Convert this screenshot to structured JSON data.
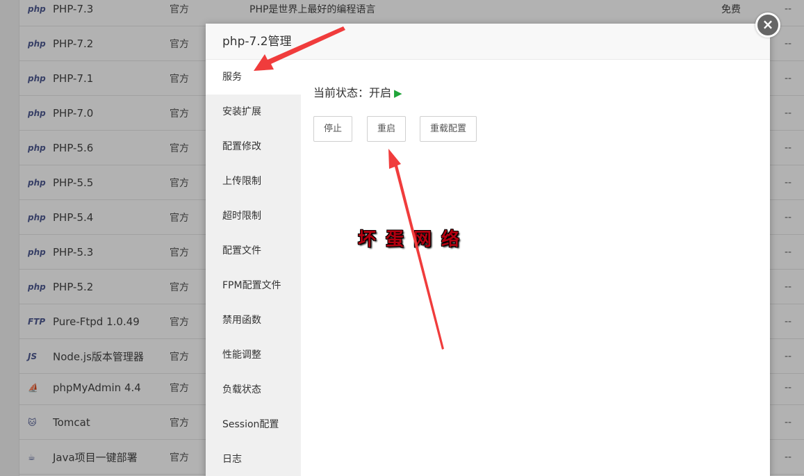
{
  "software_list": [
    {
      "icon": "php-icon",
      "icon_text": "php",
      "name": "PHP-7.3",
      "type": "官方",
      "desc": "PHP是世界上最好的编程语言",
      "price": "免费",
      "dash": "--"
    },
    {
      "icon": "php-icon",
      "icon_text": "php",
      "name": "PHP-7.2",
      "type": "官方",
      "desc": "",
      "price": "",
      "dash": "--"
    },
    {
      "icon": "php-icon",
      "icon_text": "php",
      "name": "PHP-7.1",
      "type": "官方",
      "desc": "",
      "price": "",
      "dash": "--"
    },
    {
      "icon": "php-icon",
      "icon_text": "php",
      "name": "PHP-7.0",
      "type": "官方",
      "desc": "",
      "price": "",
      "dash": "--"
    },
    {
      "icon": "php-icon",
      "icon_text": "php",
      "name": "PHP-5.6",
      "type": "官方",
      "desc": "",
      "price": "",
      "dash": "--"
    },
    {
      "icon": "php-icon",
      "icon_text": "php",
      "name": "PHP-5.5",
      "type": "官方",
      "desc": "",
      "price": "",
      "dash": "--"
    },
    {
      "icon": "php-icon",
      "icon_text": "php",
      "name": "PHP-5.4",
      "type": "官方",
      "desc": "",
      "price": "",
      "dash": "--"
    },
    {
      "icon": "php-icon",
      "icon_text": "php",
      "name": "PHP-5.3",
      "type": "官方",
      "desc": "",
      "price": "",
      "dash": "--"
    },
    {
      "icon": "php-icon",
      "icon_text": "php",
      "name": "PHP-5.2",
      "type": "官方",
      "desc": "",
      "price": "",
      "dash": "--"
    },
    {
      "icon": "ftp-icon",
      "icon_text": "FTP",
      "name": "Pure-Ftpd 1.0.49",
      "type": "官方",
      "desc": "",
      "price": "",
      "dash": "--"
    },
    {
      "icon": "nodejs-icon",
      "icon_text": "JS",
      "name": "Node.js版本管理器",
      "type": "官方",
      "desc": "",
      "price": "",
      "dash": "--"
    },
    {
      "icon": "phpmyadmin-icon",
      "icon_text": "⛵",
      "name": "phpMyAdmin 4.4",
      "type": "官方",
      "desc": "",
      "price": "",
      "dash": "--"
    },
    {
      "icon": "tomcat-icon",
      "icon_text": "🐱",
      "name": "Tomcat",
      "type": "官方",
      "desc": "",
      "price": "",
      "dash": "--"
    },
    {
      "icon": "java-icon",
      "icon_text": "☕",
      "name": "Java项目一键部署",
      "type": "官方",
      "desc": "",
      "price": "",
      "dash": "--"
    }
  ],
  "modal": {
    "title": "php-7.2管理",
    "nav": [
      "服务",
      "安装扩展",
      "配置修改",
      "上传限制",
      "超时限制",
      "配置文件",
      "FPM配置文件",
      "禁用函数",
      "性能调整",
      "负载状态",
      "Session配置",
      "日志"
    ],
    "active_nav": "服务",
    "status_label": "当前状态：开启",
    "buttons": {
      "stop": "停止",
      "restart": "重启",
      "reload": "重载配置"
    },
    "close": "×"
  },
  "watermark": "坏蛋网络",
  "colors": {
    "status_on": "#20a53a",
    "arrow": "#f03c3c",
    "watermark": "#b10010"
  }
}
